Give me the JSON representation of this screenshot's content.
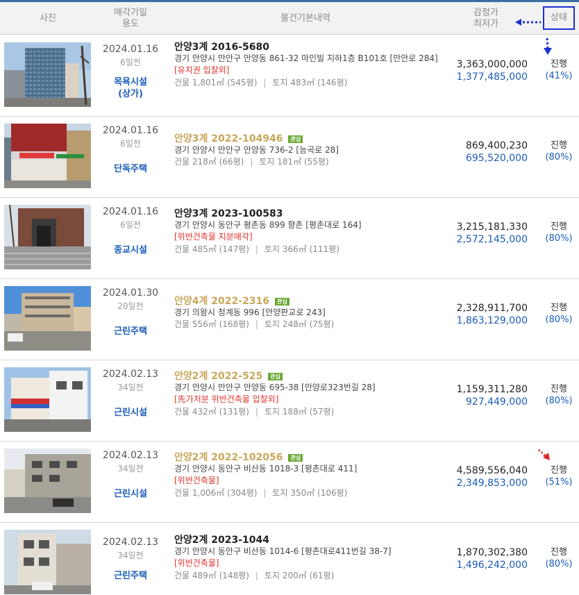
{
  "header": {
    "photo": "사진",
    "date_line1": "매각기일",
    "date_line2": "용도",
    "info": "물건기본내역",
    "price_line1": "감정가",
    "price_line2": "최저가",
    "status": "상태"
  },
  "rows": [
    {
      "date": "2024.01.16",
      "days": "6일전",
      "usage_line1": "목욕시설",
      "usage_line2": "(상가)",
      "case": "안양3계 2016-5680",
      "tag": "",
      "addr": "경기 안양시 만안구 안양동 861-32 마인빌 지하1층 B101호 [만안로 284]",
      "warn": "[유치권   입찰외]",
      "building": "건물 1,801㎡ (545평)",
      "land": "토지 483㎡ (146평)",
      "appraisal": "3,363,000,000",
      "minimum": "1,377,485,000",
      "status": "진행",
      "pct": "(41%)"
    },
    {
      "date": "2024.01.16",
      "days": "6일전",
      "usage_line1": "단독주택",
      "usage_line2": "",
      "case": "안양3계 2022-104946",
      "tag": "관심",
      "addr": "경기 안양시 만안구 안양동 736-2 [능곡로 28]",
      "warn": "",
      "building": "건물 218㎡ (66평)",
      "land": "토지 181㎡ (55평)",
      "appraisal": "869,400,230",
      "minimum": "695,520,000",
      "status": "진행",
      "pct": "(80%)"
    },
    {
      "date": "2024.01.16",
      "days": "6일전",
      "usage_line1": "종교시설",
      "usage_line2": "",
      "case": "안양3계 2023-100583",
      "tag": "",
      "addr": "경기 안양시 동안구 평촌동 899 향촌 [평촌대로 164]",
      "warn": "[위반건축물   지분매각]",
      "building": "건물 485㎡ (147평)",
      "land": "토지 366㎡ (111평)",
      "appraisal": "3,215,181,330",
      "minimum": "2,572,145,000",
      "status": "진행",
      "pct": "(80%)"
    },
    {
      "date": "2024.01.30",
      "days": "20일전",
      "usage_line1": "근린주택",
      "usage_line2": "",
      "case": "안양4계 2022-2316",
      "tag": "관심",
      "addr": "경기 의왕시 청계동 996 [안양판교로 243]",
      "warn": "",
      "building": "건물 556㎡ (168평)",
      "land": "토지 248㎡ (75평)",
      "appraisal": "2,328,911,700",
      "minimum": "1,863,129,000",
      "status": "진행",
      "pct": "(80%)"
    },
    {
      "date": "2024.02.13",
      "days": "34일전",
      "usage_line1": "근린시설",
      "usage_line2": "",
      "case": "안양2계 2022-525",
      "tag": "관심",
      "addr": "경기 안양시 만안구 안양동 695-38 [안양로323번길 28]",
      "warn": "[先가처분   위반건축물   입찰외]",
      "building": "건물 432㎡ (131평)",
      "land": "토지 188㎡ (57평)",
      "appraisal": "1,159,311,280",
      "minimum": "927,449,000",
      "status": "진행",
      "pct": "(80%)"
    },
    {
      "date": "2024.02.13",
      "days": "34일전",
      "usage_line1": "근린시설",
      "usage_line2": "",
      "case": "안양2계 2022-102056",
      "tag": "관심",
      "addr": "경기 안양시 동안구 비산동 1018-3 [평촌대로 411]",
      "warn": "[위반건축물]",
      "building": "건물 1,006㎡ (304평)",
      "land": "토지 350㎡ (106평)",
      "appraisal": "4,589,556,040",
      "minimum": "2,349,853,000",
      "status": "진행",
      "pct": "(51%)"
    },
    {
      "date": "2024.02.13",
      "days": "34일전",
      "usage_line1": "근린주택",
      "usage_line2": "",
      "case": "안양2계 2023-1044",
      "tag": "",
      "addr": "경기 안양시 동안구 비산동 1014-6 [평촌대로411번길 38-7]",
      "warn": "[위반건축물]",
      "building": "건물 489㎡ (148평)",
      "land": "토지 200㎡ (61평)",
      "appraisal": "1,870,302,380",
      "minimum": "1,496,242,000",
      "status": "진행",
      "pct": "(80%)"
    }
  ],
  "colors": {
    "header_line": "#3b6ea5",
    "header_bg": "#f2f2f2",
    "usage_blue": "#1a5cb8",
    "gold_case": "#c9a75a",
    "warn_red": "#e0302a",
    "tag_green": "#69a832",
    "annotation_blue": "#1a2fd6",
    "annotation_red": "#e02020"
  },
  "icons": {
    "annotation_left": "dotted-arrow-left-icon",
    "annotation_down": "dotted-arrow-down-icon",
    "annotation_red": "dotted-arrow-red-icon"
  }
}
